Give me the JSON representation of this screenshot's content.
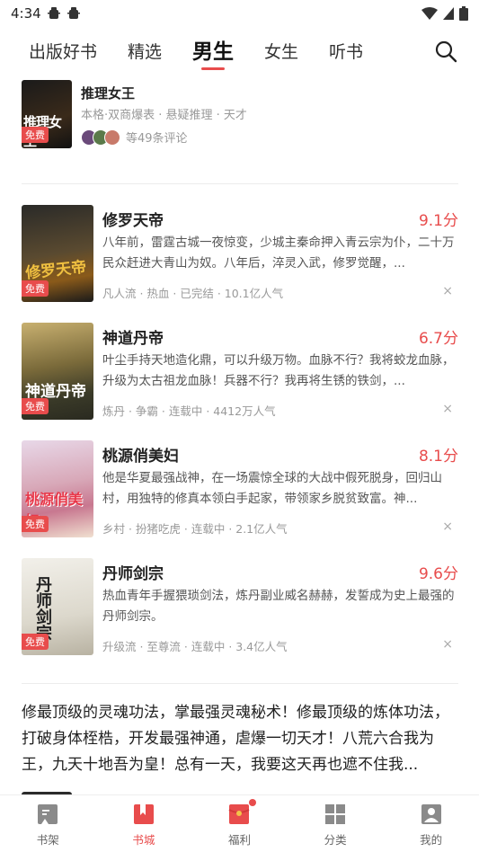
{
  "status_bar": {
    "time": "4:34"
  },
  "top_tabs": [
    {
      "label": "出版好书",
      "active": false
    },
    {
      "label": "精选",
      "active": false
    },
    {
      "label": "男生",
      "active": true
    },
    {
      "label": "女生",
      "active": false
    },
    {
      "label": "听书",
      "active": false
    }
  ],
  "top_card": {
    "title": "推理女王",
    "tags": "本格·双商爆表 · 悬疑推理 · 天才",
    "comments": "等49条评论",
    "free_label": "免费",
    "cover_text": "推理女王"
  },
  "books": [
    {
      "title": "修罗天帝",
      "score": "9.1分",
      "desc": "八年前，雷霆古城一夜惊变，少城主秦命押入青云宗为仆，二十万民众赶进大青山为奴。八年后，淬灵入武，修罗觉醒，...",
      "meta": "凡人流 · 热血 · 已完结 · 10.1亿人气",
      "free_label": "免费",
      "cover_text": "修罗天帝"
    },
    {
      "title": "神道丹帝",
      "score": "6.7分",
      "desc": "叶尘手持天地造化鼎，可以升级万物。血脉不行？我将蛟龙血脉，升级为太古祖龙血脉！兵器不行？我再将生锈的铁剑，...",
      "meta": "炼丹 · 争霸 · 连载中 · 4412万人气",
      "free_label": "免费",
      "cover_text": "神道丹帝"
    },
    {
      "title": "桃源俏美妇",
      "score": "8.1分",
      "desc": "他是华夏最强战神，在一场震惊全球的大战中假死脱身，回归山村，用独特的修真本领白手起家，带领家乡脱贫致富。神...",
      "meta": "乡村 · 扮猪吃虎 · 连载中 · 2.1亿人气",
      "free_label": "免费",
      "cover_text": "桃源俏美妇"
    },
    {
      "title": "丹师剑宗",
      "score": "9.6分",
      "desc": "热血青年手握猥琐剑法，炼丹副业威名赫赫，发誓成为史上最强的丹师剑宗。",
      "meta": "升级流 · 至尊流 · 连载中 · 3.4亿人气",
      "free_label": "免费",
      "cover_text": "丹师剑宗"
    }
  ],
  "close_symbol": "×",
  "promo_text": "修最顶级的灵魂功法，掌最强灵魂秘术！修最顶级的炼体功法，打破身体桎梏，开发最强神通，虐爆一切天才！八荒六合我为王，九天十地吾为皇！总有一天，我要这天再也遮不住我...",
  "bottom_nav": [
    {
      "label": "书架",
      "icon": "bookshelf-icon",
      "active": false
    },
    {
      "label": "书城",
      "icon": "bookstore-icon",
      "active": true
    },
    {
      "label": "福利",
      "icon": "gift-icon",
      "active": false
    },
    {
      "label": "分类",
      "icon": "category-icon",
      "active": false
    },
    {
      "label": "我的",
      "icon": "profile-icon",
      "active": false
    }
  ],
  "colors": {
    "accent": "#e84c4c",
    "text": "#222222",
    "muted": "#999999"
  }
}
